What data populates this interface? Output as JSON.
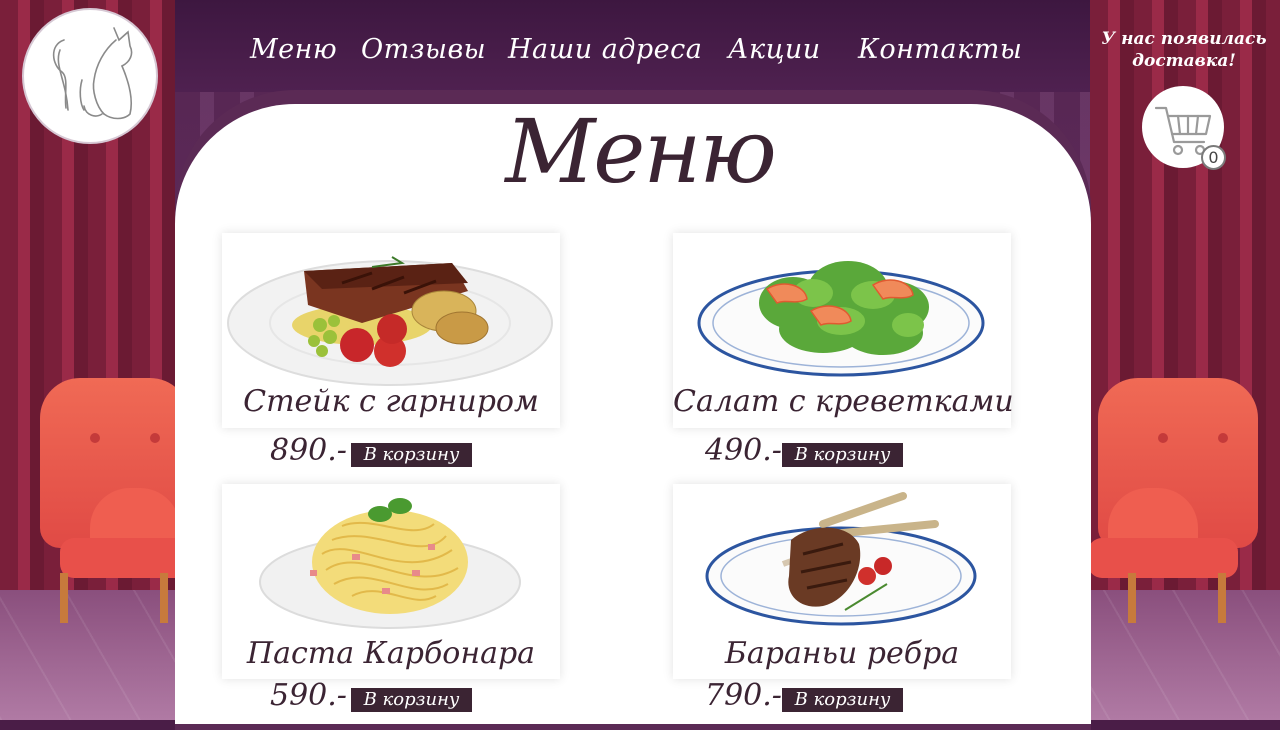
{
  "nav": {
    "items": [
      "Меню",
      "Отзывы",
      "Наши адреса",
      "Акции",
      "Контакты"
    ]
  },
  "promo": {
    "line1": "У нас появилась",
    "line2": "доставка!"
  },
  "cart": {
    "count": "0",
    "icon": "shopping-cart-icon"
  },
  "logo": {
    "icon": "cat-outline-logo"
  },
  "page": {
    "title": "Меню"
  },
  "menu": {
    "button_label": "В корзину",
    "items": [
      {
        "name": "Стейк с гарниром",
        "price": "890.-"
      },
      {
        "name": "Салат с креветками",
        "price": "490.-"
      },
      {
        "name": "Паста Карбонара",
        "price": "590.-"
      },
      {
        "name": "Бараньи ребра",
        "price": "790.-"
      }
    ]
  },
  "colors": {
    "accent": "#3b2433",
    "header_bg": "#4f2150",
    "panel_bg": "#ffffff"
  }
}
